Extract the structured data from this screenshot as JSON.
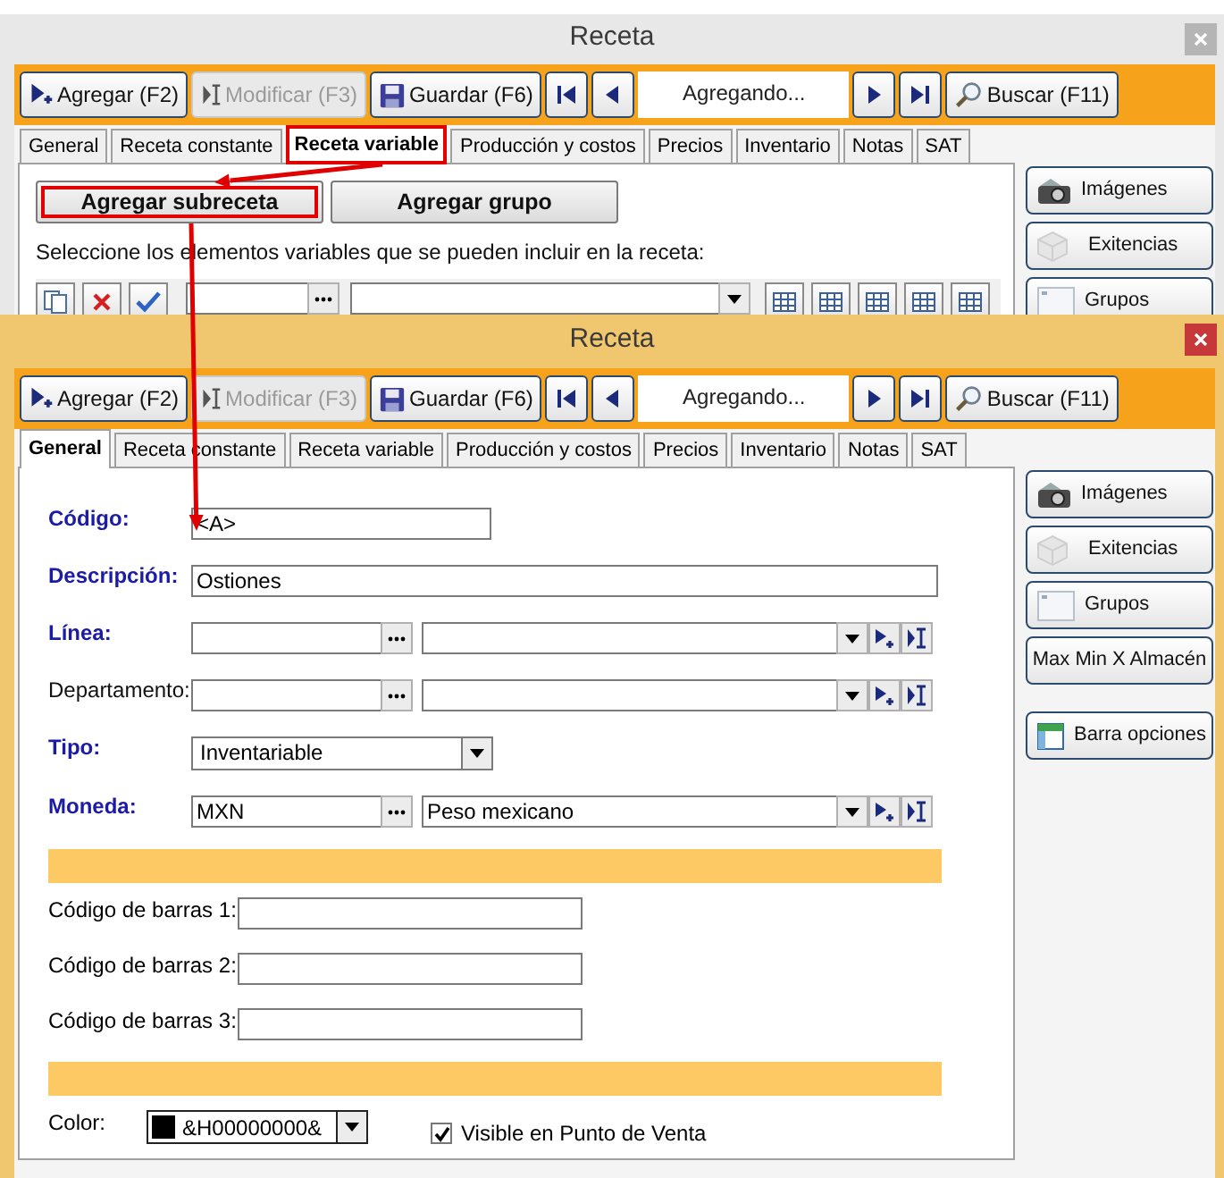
{
  "windows": [
    {
      "title": "Receta",
      "active": false,
      "toolbar": [
        {
          "kind": "add",
          "label": "Agregar (F2)",
          "disabled": false
        },
        {
          "kind": "edit",
          "label": "Modificar (F3)",
          "disabled": true
        },
        {
          "kind": "save",
          "label": "Guardar (F6)",
          "disabled": false
        },
        {
          "kind": "first"
        },
        {
          "kind": "previous"
        },
        {
          "kind": "record",
          "label": "Agregando..."
        },
        {
          "kind": "next"
        },
        {
          "kind": "last"
        },
        {
          "kind": "search",
          "label": "Buscar (F11)",
          "disabled": false
        }
      ],
      "tabs": [
        {
          "label": "General",
          "selected": false,
          "highlighted": false
        },
        {
          "label": "Receta constante",
          "selected": false,
          "highlighted": false
        },
        {
          "label": "Receta variable",
          "selected": true,
          "highlighted": true
        },
        {
          "label": "Producción y costos",
          "selected": false,
          "highlighted": false
        },
        {
          "label": "Precios",
          "selected": false,
          "highlighted": false
        },
        {
          "label": "Inventario",
          "selected": false,
          "highlighted": false
        },
        {
          "label": "Notas",
          "selected": false,
          "highlighted": false
        },
        {
          "label": "SAT",
          "selected": false,
          "highlighted": false
        }
      ],
      "side_buttons": [
        {
          "kind": "images",
          "label": "Imágenes"
        },
        {
          "kind": "stock",
          "label": "Exitencias"
        },
        {
          "kind": "groups",
          "label": "Grupos"
        }
      ],
      "content": {
        "kind": "variable_recipe",
        "buttons": [
          {
            "label": "Agregar subreceta",
            "highlighted": true
          },
          {
            "label": "Agregar grupo",
            "highlighted": false
          }
        ],
        "instruction": "Seleccione los elementos variables que se pueden incluir en la receta:"
      }
    },
    {
      "title": "Receta",
      "active": true,
      "toolbar": [
        {
          "kind": "add",
          "label": "Agregar (F2)",
          "disabled": false
        },
        {
          "kind": "edit",
          "label": "Modificar (F3)",
          "disabled": true
        },
        {
          "kind": "save",
          "label": "Guardar (F6)",
          "disabled": false
        },
        {
          "kind": "first"
        },
        {
          "kind": "previous"
        },
        {
          "kind": "record",
          "label": "Agregando..."
        },
        {
          "kind": "next"
        },
        {
          "kind": "last"
        },
        {
          "kind": "search",
          "label": "Buscar (F11)",
          "disabled": false
        }
      ],
      "tabs": [
        {
          "label": "General",
          "selected": true
        },
        {
          "label": "Receta constante",
          "selected": false
        },
        {
          "label": "Receta variable",
          "selected": false
        },
        {
          "label": "Producción y costos",
          "selected": false
        },
        {
          "label": "Precios",
          "selected": false
        },
        {
          "label": "Inventario",
          "selected": false
        },
        {
          "label": "Notas",
          "selected": false
        },
        {
          "label": "SAT",
          "selected": false
        }
      ],
      "side_buttons": [
        {
          "kind": "images",
          "label": "Imágenes"
        },
        {
          "kind": "stock",
          "label": "Exitencias"
        },
        {
          "kind": "groups",
          "label": "Grupos"
        },
        {
          "kind": "text",
          "label": "Max Min X Almacén"
        },
        {
          "kind": "options",
          "label": "Barra opciones"
        }
      ],
      "content": {
        "kind": "general",
        "fields": [
          {
            "kind": "short_text",
            "label": "Código:",
            "required": true,
            "value": "<A>"
          },
          {
            "kind": "long_text",
            "label": "Descripción:",
            "required": true,
            "value": "Ostiones"
          },
          {
            "kind": "lookup",
            "label": "Línea:",
            "required": true
          },
          {
            "kind": "lookup",
            "label": "Departamento:",
            "required": false
          },
          {
            "kind": "select",
            "label": "Tipo:",
            "required": true,
            "value": "Inventariable"
          },
          {
            "kind": "lookup",
            "label": "Moneda:",
            "required": true,
            "code": "MXN",
            "name": "Peso mexicano"
          }
        ],
        "barcodes": [
          {
            "label": "Código de barras 1:"
          },
          {
            "label": "Código de barras 2:"
          },
          {
            "label": "Código de barras 3:"
          }
        ],
        "color": {
          "label": "Color:",
          "value": "&H00000000&",
          "color": "#000000"
        },
        "visible_in_pos": {
          "label": "Visible en Punto de Venta",
          "checked": true
        }
      }
    }
  ]
}
